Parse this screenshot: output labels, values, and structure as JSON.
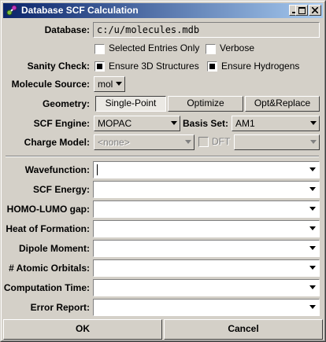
{
  "window": {
    "title": "Database SCF Calculation"
  },
  "titlebar_buttons": [
    "minimize-icon",
    "maximize-icon",
    "close-icon"
  ],
  "database": {
    "label": "Database:",
    "value": "c:/u/molecules.mdb"
  },
  "options": {
    "selected_only": {
      "label": "Selected Entries Only",
      "checked": false
    },
    "verbose": {
      "label": "Verbose",
      "checked": false
    }
  },
  "sanity": {
    "label": "Sanity Check:",
    "ensure_3d": {
      "label": "Ensure 3D Structures",
      "checked": true
    },
    "ensure_h": {
      "label": "Ensure Hydrogens",
      "checked": true
    }
  },
  "molecule_source": {
    "label": "Molecule Source:",
    "value": "mol"
  },
  "geometry": {
    "label": "Geometry:",
    "options": [
      "Single-Point",
      "Optimize",
      "Opt&Replace"
    ],
    "selected": "Single-Point"
  },
  "scf_engine": {
    "label": "SCF Engine:",
    "value": "MOPAC"
  },
  "basis_set": {
    "label": "Basis Set:",
    "value": "AM1"
  },
  "charge_model": {
    "label": "Charge Model:",
    "value": "<none>"
  },
  "dft": {
    "label": "DFT",
    "checked": false,
    "value": ""
  },
  "results": [
    {
      "label": "Wavefunction:",
      "value": ""
    },
    {
      "label": "SCF Energy:",
      "value": ""
    },
    {
      "label": "HOMO-LUMO gap:",
      "value": ""
    },
    {
      "label": "Heat of Formation:",
      "value": ""
    },
    {
      "label": "Dipole Moment:",
      "value": ""
    },
    {
      "label": "# Atomic Orbitals:",
      "value": ""
    },
    {
      "label": "Computation Time:",
      "value": ""
    },
    {
      "label": "Error Report:",
      "value": ""
    }
  ],
  "buttons": {
    "ok": "OK",
    "cancel": "Cancel"
  }
}
